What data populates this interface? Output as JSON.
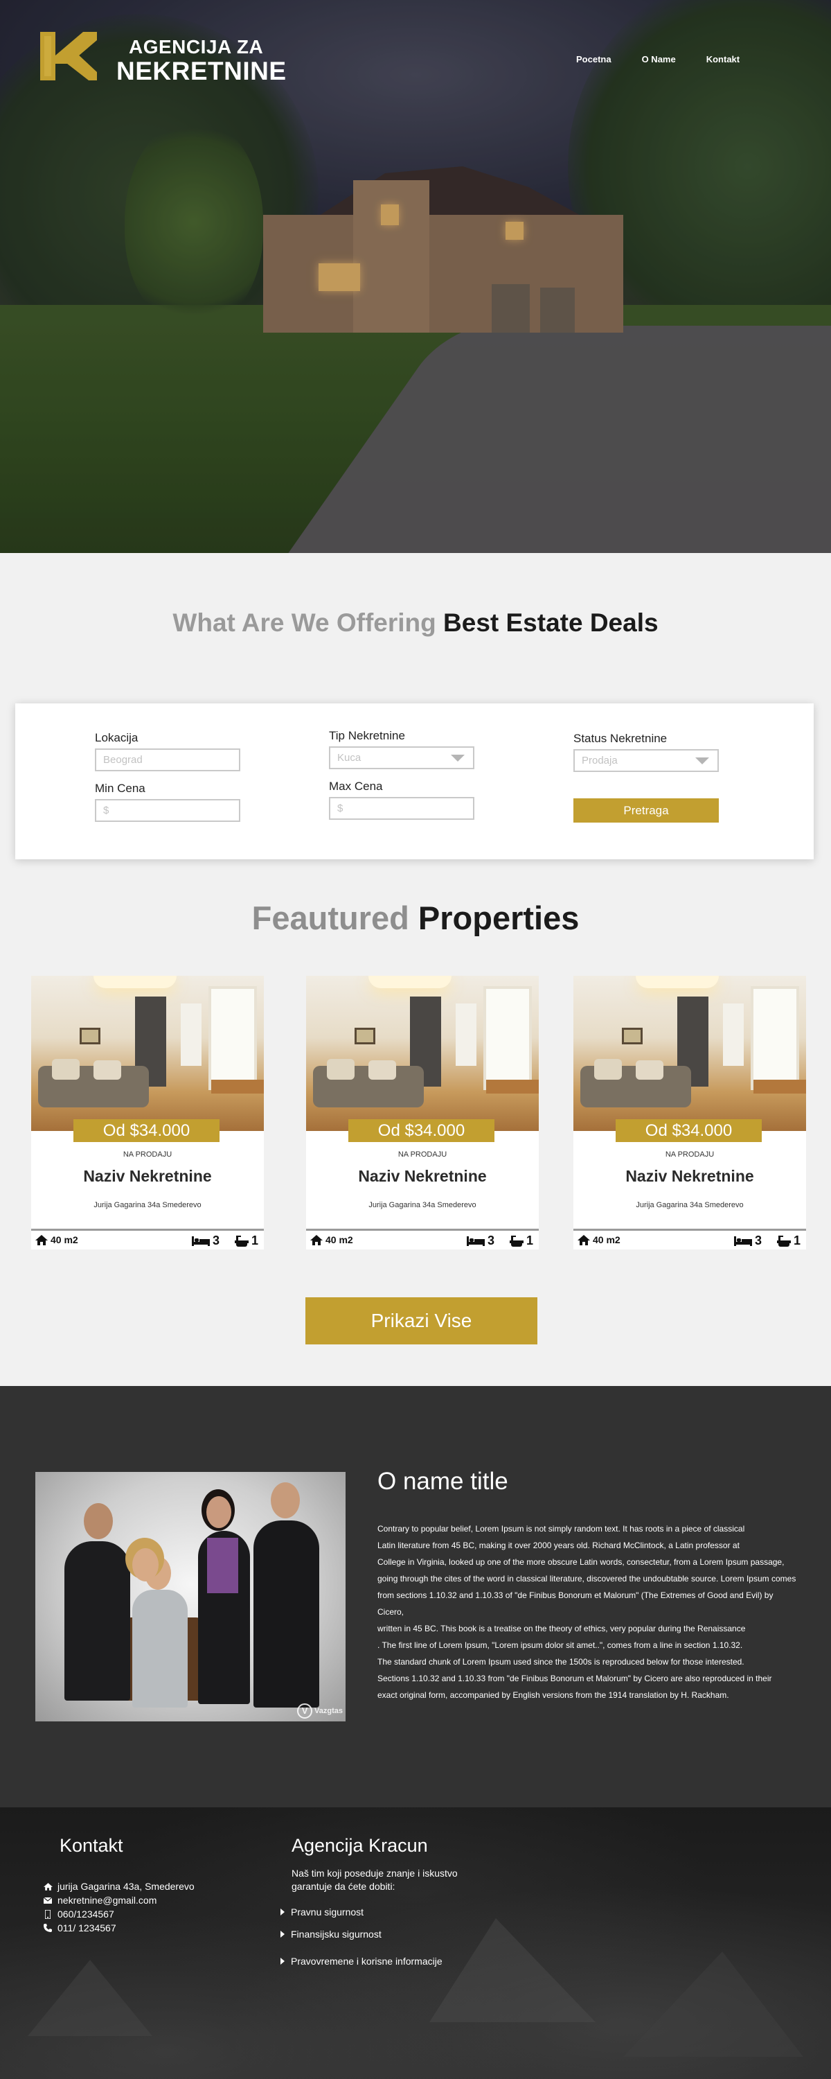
{
  "brand": {
    "line1": "AGENCIJA ZA",
    "line2": "NEKRETNINE",
    "accent_color": "#c29f30"
  },
  "nav": {
    "items": [
      "Pocetna",
      "O Name",
      "Kontakt"
    ]
  },
  "offering": {
    "title_muted": "What Are We Offering",
    "title_dark": "Best Estate Deals"
  },
  "search": {
    "location_label": "Lokacija",
    "location_placeholder": "Beograd",
    "type_label": "Tip Nekretnine",
    "type_value": "Kuca",
    "status_label": "Status Nekretnine",
    "status_value": "Prodaja",
    "min_price_label": "Min Cena",
    "min_price_placeholder": "$",
    "max_price_label": "Max Cena",
    "max_price_placeholder": "$",
    "submit_label": "Pretraga"
  },
  "featured": {
    "title_muted": "Feautured",
    "title_dark": "Properties",
    "cards": [
      {
        "price": "Od $34.000",
        "status": "NA PRODAJU",
        "name": "Naziv Nekretnine",
        "address": "Jurija Gagarina 34a  Smederevo",
        "area": "40 m2",
        "beds": "3",
        "baths": "1"
      },
      {
        "price": "Od $34.000",
        "status": "NA PRODAJU",
        "name": "Naziv Nekretnine",
        "address": "Jurija Gagarina 34a  Smederevo",
        "area": "40 m2",
        "beds": "3",
        "baths": "1"
      },
      {
        "price": "Od $34.000",
        "status": "NA PRODAJU",
        "name": "Naziv Nekretnine",
        "address": "Jurija Gagarina 34a  Smederevo",
        "area": "40 m2",
        "beds": "3",
        "baths": "1"
      }
    ],
    "more_label": "Prikazi Vise"
  },
  "about": {
    "title": "O name title",
    "paragraph1_lines": [
      "Contrary to popular belief, Lorem Ipsum is not simply random text. It has roots in a piece of classical",
      " Latin literature from 45 BC, making it over 2000 years old. Richard McClintock, a Latin professor at",
      " College in Virginia, looked up one of the more obscure Latin words, consectetur, from a Lorem Ipsum passage,",
      "going through the cites of the word in classical literature, discovered the undoubtable source. Lorem Ipsum comes",
      "from sections 1.10.32 and 1.10.33 of \"de Finibus Bonorum et Malorum\" (The Extremes of Good and Evil) by Cicero,",
      " written in 45 BC. This book is a treatise on the theory of ethics, very popular during the Renaissance",
      ". The first line of Lorem Ipsum, \"Lorem ipsum dolor sit amet..\", comes from a line in section 1.10.32."
    ],
    "paragraph2_lines": [
      "The standard chunk of Lorem Ipsum used since the 1500s is reproduced below for those interested.",
      "Sections 1.10.32 and 1.10.33 from \"de Finibus Bonorum et Malorum\" by Cicero are also reproduced in their",
      "exact original form, accompanied by English versions from the 1914 translation by H. Rackham."
    ],
    "watermark": "Vazgtas"
  },
  "footer": {
    "contact_title": "Kontakt",
    "contact_items": [
      {
        "icon": "home-icon",
        "text": "jurija Gagarina 43a,  Smederevo"
      },
      {
        "icon": "envelope-icon",
        "text": "nekretnine@gmail.com"
      },
      {
        "icon": "mobile-icon",
        "text": "060/1234567"
      },
      {
        "icon": "phone-icon",
        "text": "011/ 1234567"
      }
    ],
    "agency_title": "Agencija Kracun",
    "agency_intro": "Naš tim koji poseduje znanje i iskustvo garantuje da ćete dobiti:",
    "services": [
      "Pravnu sigurnost",
      "Finansijsku sigurnost",
      "Pravovremene i korisne informacije"
    ]
  }
}
